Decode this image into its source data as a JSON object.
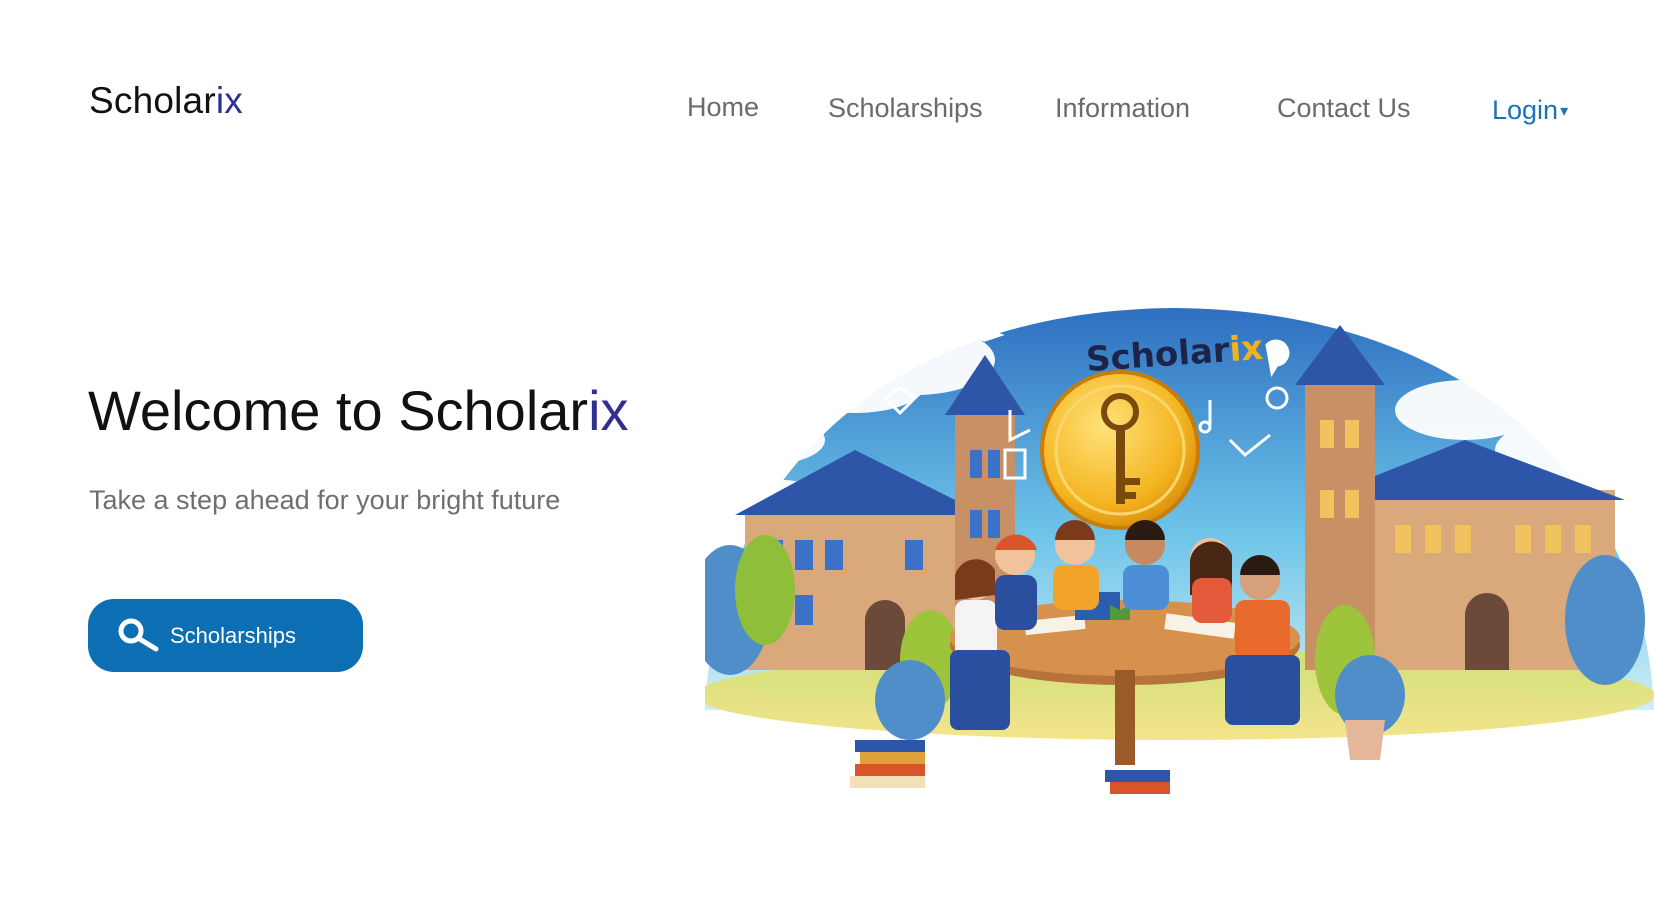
{
  "brand": {
    "name_main": "Scholar",
    "name_accent": "ix"
  },
  "nav": {
    "home": "Home",
    "scholarships": "Scholarships",
    "information": "Information",
    "contact": "Contact Us",
    "login": "Login",
    "login_caret": "▾"
  },
  "hero": {
    "title_main": "Welcome to Scholar",
    "title_accent": "ix",
    "subtitle": "Take a step ahead for your bright future",
    "cta_label": "Scholarships",
    "cta_icon": "search-icon"
  },
  "illustration": {
    "banner_main": "Scholar",
    "banner_accent": "ix",
    "description_icon": "students-at-table-illustration"
  },
  "colors": {
    "accent": "#2e2f91",
    "primary_button": "#0d6fb3",
    "login_link": "#1b73b8",
    "nav_text": "#6b6b6b"
  }
}
